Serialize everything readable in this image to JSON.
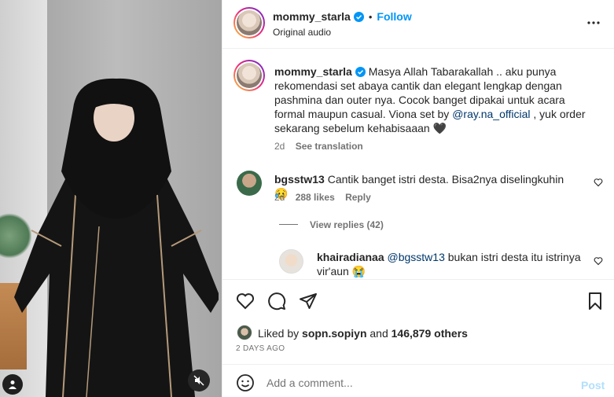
{
  "header": {
    "username": "mommy_starla",
    "dot": "•",
    "follow_label": "Follow",
    "audio": "Original audio"
  },
  "caption": {
    "username": "mommy_starla",
    "text_1": "Masya Allah Tabarakallah .. aku punya rekomendasi set abaya cantik dan elegant lengkap dengan pashmina dan outer nya. Cocok banget dipakai untuk acara formal maupun casual. Viona set by",
    "mention": "@ray.na_official",
    "text_2": ", yuk order sekarang sebelum kehabisaaan",
    "emoji": "🖤",
    "time": "2d",
    "translate": "See translation"
  },
  "comments": [
    {
      "username": "bgsstw13",
      "text": "Cantik banget istri desta. Bisa2nya diselingkuhin",
      "emoji": "😥",
      "time": "2d",
      "likes": "288 likes",
      "reply": "Reply"
    }
  ],
  "view_replies": "View replies (42)",
  "reply": {
    "username": "khairadianaa",
    "mention": "@bgsstw13",
    "text": "bukan istri desta itu istrinya vir'aun",
    "emoji": "😭"
  },
  "likes": {
    "prefix": "Liked by",
    "user": "sopn.sopiyn",
    "and": "and",
    "count": "146,879 others"
  },
  "post_date": "2 DAYS AGO",
  "add_comment": {
    "placeholder": "Add a comment...",
    "post": "Post"
  },
  "colors": {
    "accent": "#0095f6",
    "mention": "#00376b",
    "muted": "#737373"
  }
}
